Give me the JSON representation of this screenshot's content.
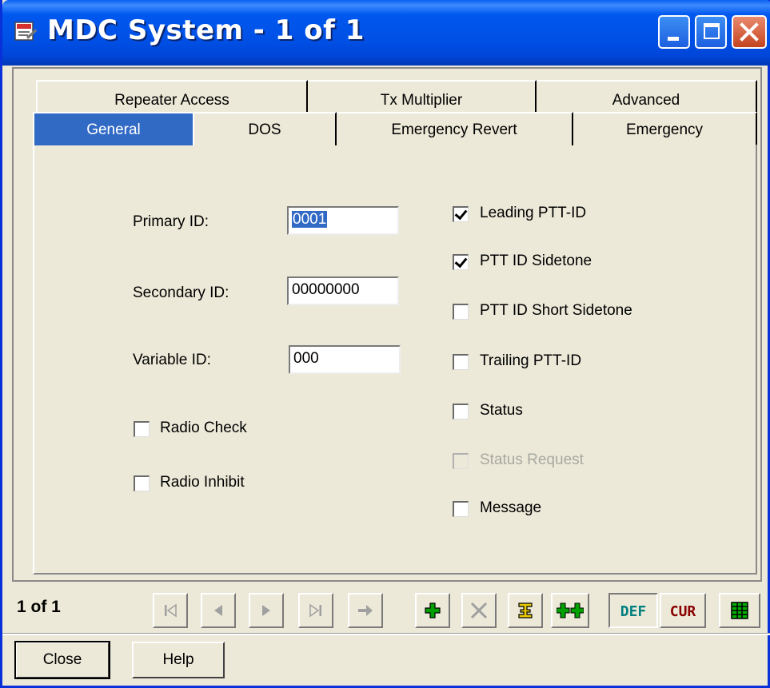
{
  "window": {
    "title": "MDC System - 1 of 1",
    "title_color": "#FFFFFF",
    "titlebar_color": "#0054E3"
  },
  "tabs": {
    "row_top": [
      "Repeater Access",
      "Tx Multiplier",
      "Advanced"
    ],
    "row_bottom": [
      "General",
      "DOS",
      "Emergency Revert",
      "Emergency"
    ],
    "active": "General",
    "active_color": "#316AC5"
  },
  "general": {
    "primary_id": {
      "label": "Primary ID:",
      "value": "0001"
    },
    "secondary_id": {
      "label": "Secondary ID:",
      "value": "00000000"
    },
    "variable_id": {
      "label": "Variable ID:",
      "value": "000"
    },
    "radio_check": {
      "label": "Radio Check",
      "checked": false
    },
    "radio_inhibit": {
      "label": "Radio Inhibit",
      "checked": false
    },
    "leading_ptt_id": {
      "label": "Leading PTT-ID",
      "checked": true
    },
    "ptt_id_sidetone": {
      "label": "PTT ID Sidetone",
      "checked": true
    },
    "ptt_id_short_sidetone": {
      "label": "PTT ID Short Sidetone",
      "checked": false
    },
    "trailing_ptt_id": {
      "label": "Trailing PTT-ID",
      "checked": false
    },
    "status": {
      "label": "Status",
      "checked": false
    },
    "status_request": {
      "label": "Status Request",
      "checked": false,
      "disabled": true
    },
    "message": {
      "label": "Message",
      "checked": false
    }
  },
  "navigation": {
    "page_count": "1 of 1",
    "buttons": [
      {
        "name": "first-record",
        "icon": "first-icon",
        "glyph": "⏮",
        "enabled": false
      },
      {
        "name": "previous-record",
        "icon": "previous-icon",
        "glyph": "◀",
        "enabled": false
      },
      {
        "name": "next-record",
        "icon": "next-icon",
        "glyph": "▶",
        "enabled": false
      },
      {
        "name": "last-record",
        "icon": "last-icon",
        "glyph": "⏭",
        "enabled": false
      },
      {
        "name": "goto-record",
        "icon": "arrow-right-icon",
        "glyph": "➡",
        "enabled": false
      },
      {
        "name": "add-record",
        "icon": "plus-icon",
        "glyph": "✚",
        "enabled": true,
        "color": "#00A000"
      },
      {
        "name": "delete-record",
        "icon": "delete-icon",
        "glyph": "✕",
        "enabled": false
      },
      {
        "name": "insert-record",
        "icon": "insert-icon",
        "glyph": "⌶",
        "enabled": true,
        "color": "#C8A000"
      },
      {
        "name": "copy-record",
        "icon": "copy-icon",
        "glyph": "✚✚",
        "enabled": true,
        "color": "#00A000"
      }
    ],
    "def_label": "DEF",
    "def_color": "#008080",
    "cur_label": "CUR",
    "cur_color": "#8B0000",
    "grid_icon": "grid-icon",
    "grid_color": "#00A000"
  },
  "footer": {
    "close_label": "Close",
    "help_label": "Help"
  }
}
